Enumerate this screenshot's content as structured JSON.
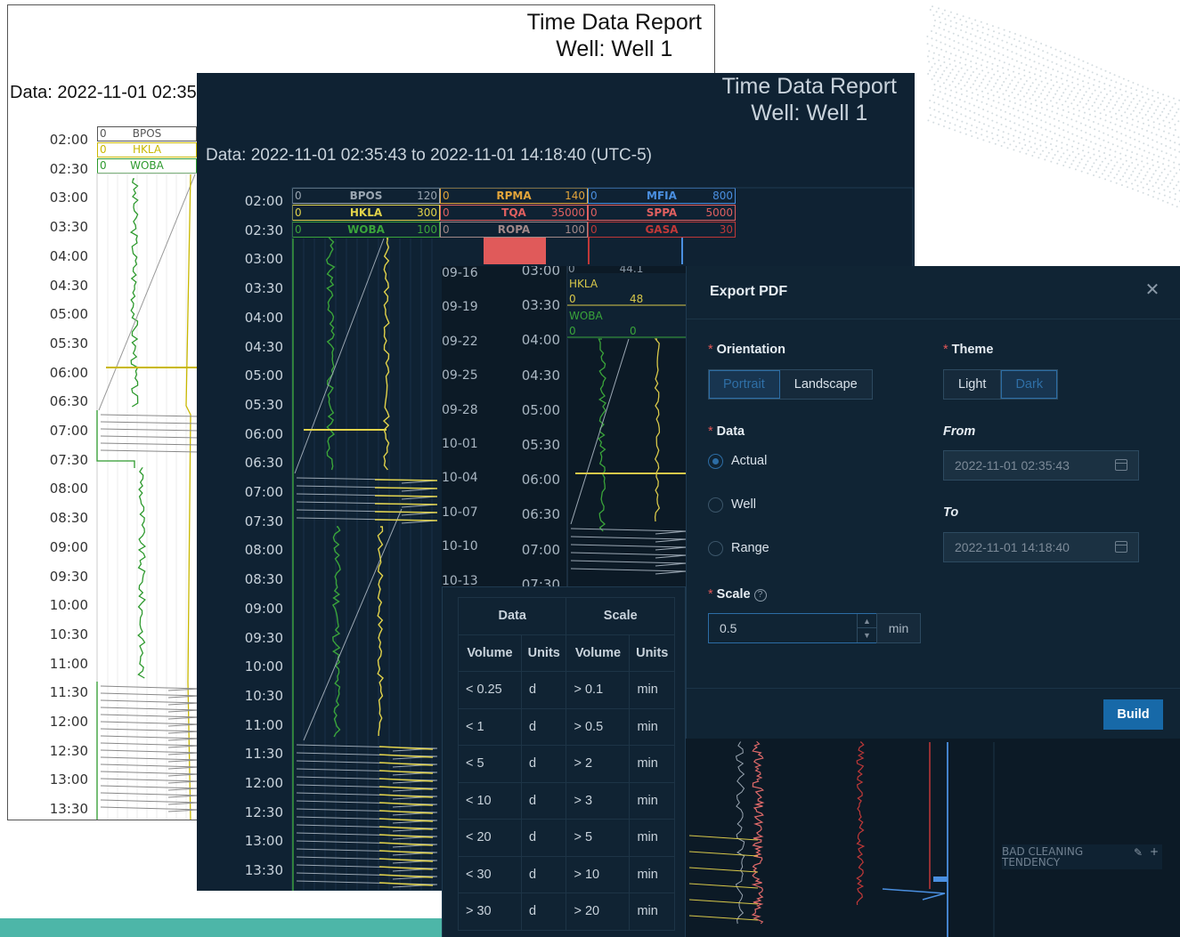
{
  "report": {
    "title_line1": "Time Data Report",
    "title_line2": "Well:  Well 1",
    "range_full": "Data: 2022-11-01 02:35:43 to 2022-11-01 14:18:40 (UTC-5)",
    "range_truncated": "Data: 2022-11-01 02:35"
  },
  "times": [
    "02:00",
    "02:30",
    "03:00",
    "03:30",
    "04:00",
    "04:30",
    "05:00",
    "05:30",
    "06:00",
    "06:30",
    "07:00",
    "07:30",
    "08:00",
    "08:30",
    "09:00",
    "09:30",
    "10:00",
    "10:30",
    "11:00",
    "11:30",
    "12:00",
    "12:30",
    "13:00",
    "13:30"
  ],
  "light_headers": [
    {
      "min": "0",
      "name": "BPOS",
      "color": "#555555"
    },
    {
      "min": "0",
      "name": "HKLA",
      "color": "#c9b800"
    },
    {
      "min": "0",
      "name": "WOBA",
      "color": "#2e9a2e"
    }
  ],
  "dark_headers": [
    {
      "min": "0",
      "name": "BPOS",
      "max": "120",
      "color": "#9aa6b2"
    },
    {
      "min": "0",
      "name": "HKLA",
      "max": "300",
      "color": "#e2d34a"
    },
    {
      "min": "0",
      "name": "WOBA",
      "max": "100",
      "color": "#3aa43a"
    },
    {
      "min": "0",
      "name": "RPMA",
      "max": "140",
      "color": "#e2a43a"
    },
    {
      "min": "0",
      "name": "TQA",
      "max": "35000",
      "color": "#e06060"
    },
    {
      "min": "0",
      "name": "ROPA",
      "max": "100",
      "color": "#a08888"
    },
    {
      "min": "0",
      "name": "MFIA",
      "max": "800",
      "color": "#4a8fe0"
    },
    {
      "min": "0",
      "name": "SPPA",
      "max": "5000",
      "color": "#e06060"
    },
    {
      "min": "0",
      "name": "GASA",
      "max": "30",
      "color": "#c03838"
    }
  ],
  "app": {
    "dates": [
      "09-16",
      "09-19",
      "09-22",
      "09-25",
      "09-28",
      "10-01",
      "10-04",
      "10-07",
      "10-10",
      "10-13"
    ],
    "times": [
      "03:00",
      "03:30",
      "04:00",
      "04:30",
      "05:00",
      "05:30",
      "06:00",
      "06:30",
      "07:00",
      "07:30"
    ],
    "headers": [
      {
        "name": "HKLA",
        "v0": "0",
        "v1": "48",
        "color": "#d8c84a"
      },
      {
        "name": "WOBA",
        "v0": "0",
        "v1": "0",
        "color": "#3aa43a"
      }
    ],
    "top_partial_value": "44.1",
    "bad_cleaning": "BAD CLEANING TENDENCY"
  },
  "legend": {
    "group_headers": [
      "Data",
      "Scale"
    ],
    "columns": [
      "Volume",
      "Units",
      "Volume",
      "Units"
    ],
    "rows": [
      [
        "< 0.25",
        "d",
        "> 0.1",
        "min"
      ],
      [
        "< 1",
        "d",
        "> 0.5",
        "min"
      ],
      [
        "< 5",
        "d",
        "> 2",
        "min"
      ],
      [
        "< 10",
        "d",
        "> 3",
        "min"
      ],
      [
        "< 20",
        "d",
        "> 5",
        "min"
      ],
      [
        "< 30",
        "d",
        "> 10",
        "min"
      ],
      [
        "> 30",
        "d",
        "> 20",
        "min"
      ]
    ]
  },
  "modal": {
    "title": "Export PDF",
    "orientation_label": "Orientation",
    "orientation_options": [
      "Portrait",
      "Landscape"
    ],
    "orientation_selected": "Portrait",
    "theme_label": "Theme",
    "theme_options": [
      "Light",
      "Dark"
    ],
    "theme_selected": "Dark",
    "data_label": "Data",
    "data_options": [
      "Actual",
      "Well",
      "Range"
    ],
    "data_selected": "Actual",
    "from_label": "From",
    "from_value": "2022-11-01 02:35:43",
    "to_label": "To",
    "to_value": "2022-11-01 14:18:40",
    "scale_label": "Scale",
    "scale_value": "0.5",
    "scale_unit": "min",
    "build_label": "Build"
  },
  "colors": {
    "accent": "#1769a8",
    "teal_band": "#4db6a8",
    "dark_bg": "#0f2233",
    "modal_bg": "#102434"
  }
}
